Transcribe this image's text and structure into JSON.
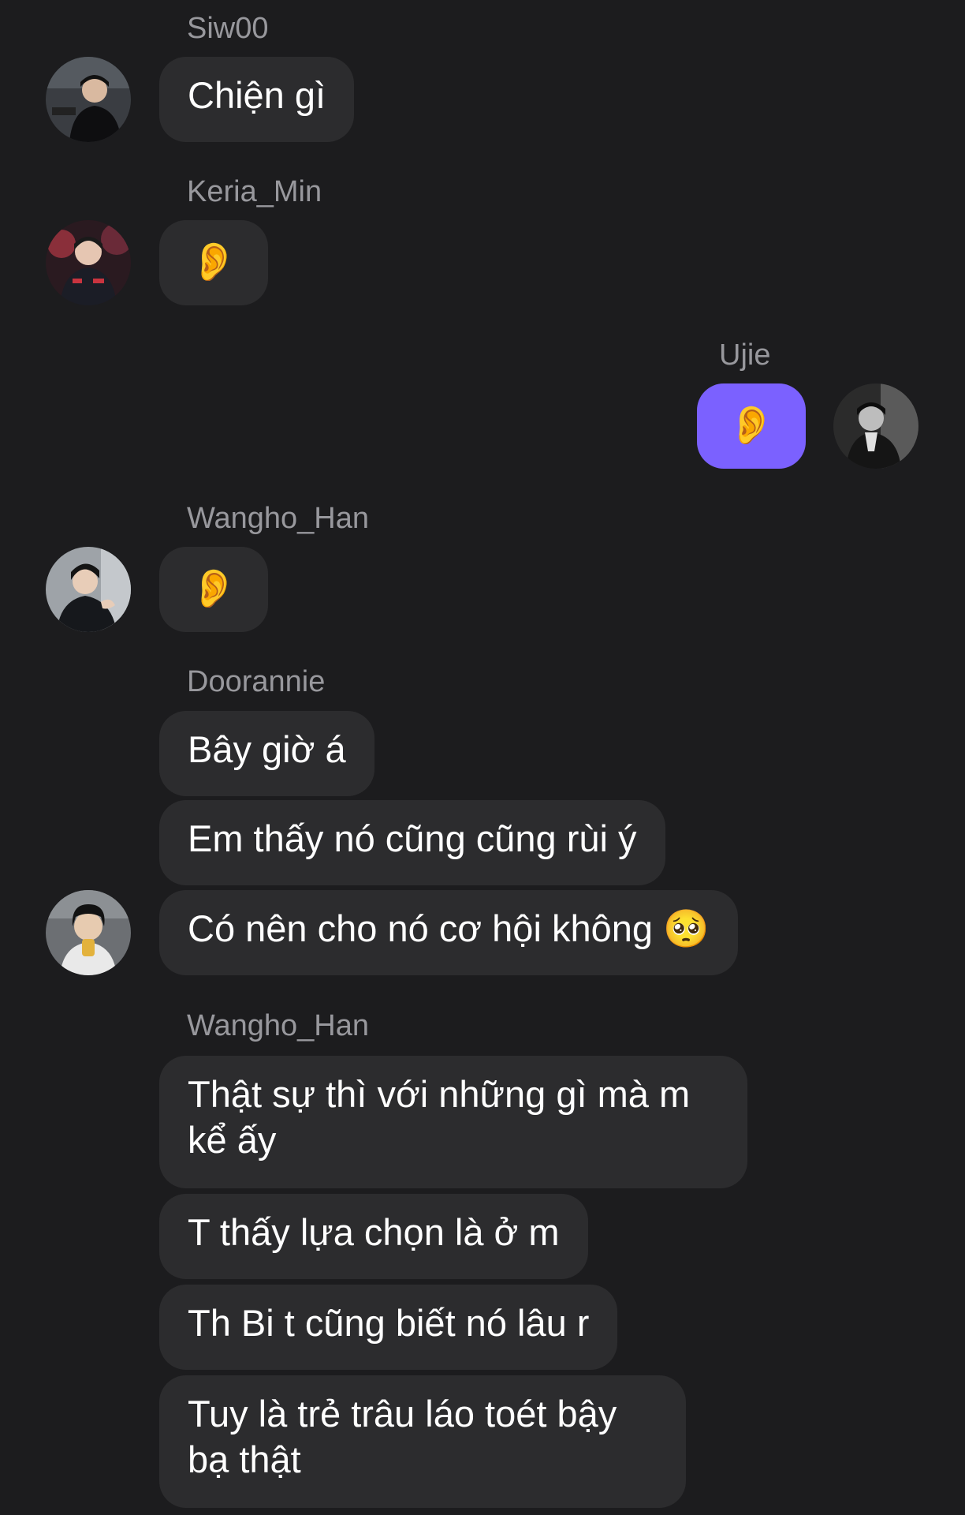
{
  "messages": [
    {
      "sender": "Siw00",
      "text": "Chiện gì"
    },
    {
      "sender": "Keria_Min",
      "text": "👂"
    },
    {
      "sender": "Ujie",
      "text": "👂"
    },
    {
      "sender": "Wangho_Han",
      "text": "👂"
    },
    {
      "sender": "Doorannie",
      "texts": [
        "Bây giờ á",
        "Em thấy nó cũng cũng rùi ý",
        "Có nên cho nó cơ hội không 🥺"
      ]
    },
    {
      "sender": "Wangho_Han",
      "texts": [
        "Thật sự thì với những gì mà m kể ấy",
        "T thấy lựa chọn là ở m",
        "Th Bi t cũng biết nó lâu r",
        "Tuy là trẻ trâu láo toét bậy bạ thật"
      ]
    }
  ],
  "theme": {
    "background": "#1c1c1e",
    "incoming_bubble": "#2c2c2e",
    "outgoing_bubble": "#7b61ff",
    "sender_name": "#98989d"
  }
}
